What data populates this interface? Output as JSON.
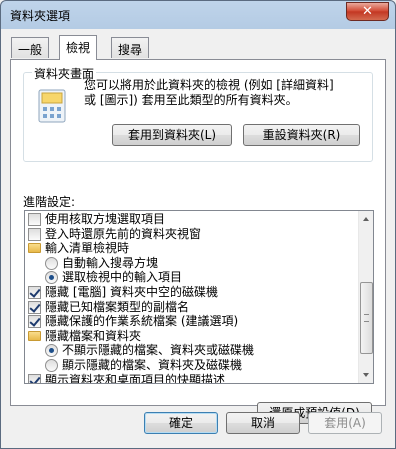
{
  "window": {
    "title": "資料夾選項",
    "close_glyph": "✕"
  },
  "tabs": [
    {
      "label": "一般"
    },
    {
      "label": "檢視"
    },
    {
      "label": "搜尋"
    }
  ],
  "folder_views": {
    "title": "資料夾畫面",
    "description_line1": "您可以將用於此資料夾的檢視 (例如 [詳細資料]",
    "description_line2": "或 [圖示]) 套用至此類型的所有資料夾。",
    "apply_button": "套用到資料夾(L)",
    "reset_button": "重設資料夾(R)"
  },
  "advanced": {
    "label": "進階設定:",
    "items": [
      {
        "type": "checkbox",
        "checked": false,
        "indent": 0,
        "label": "使用核取方塊選取項目"
      },
      {
        "type": "checkbox",
        "checked": false,
        "indent": 0,
        "label": "登入時還原先前的資料夾視窗"
      },
      {
        "type": "folder",
        "indent": 0,
        "label": "輸入清單檢視時"
      },
      {
        "type": "radio",
        "checked": false,
        "indent": 1,
        "label": "自動輸入搜尋方塊"
      },
      {
        "type": "radio",
        "checked": true,
        "indent": 1,
        "label": "選取檢視中的輸入項目"
      },
      {
        "type": "checkbox",
        "checked": true,
        "indent": 0,
        "label": "隱藏 [電腦] 資料夾中空的磁碟機"
      },
      {
        "type": "checkbox",
        "checked": true,
        "indent": 0,
        "label": "隱藏已知檔案類型的副檔名"
      },
      {
        "type": "checkbox",
        "checked": true,
        "indent": 0,
        "label": "隱藏保護的作業系統檔案 (建議選項)"
      },
      {
        "type": "folder",
        "indent": 0,
        "label": "隱藏檔案和資料夾"
      },
      {
        "type": "radio",
        "checked": true,
        "indent": 1,
        "label": "不顯示隱藏的檔案、資料夾或磁碟機"
      },
      {
        "type": "radio",
        "checked": false,
        "indent": 1,
        "label": "顯示隱藏的檔案、資料夾及磁碟機"
      },
      {
        "type": "checkbox",
        "checked": true,
        "indent": 0,
        "label": "顯示資料夾和桌面項目的快顯描述"
      },
      {
        "type": "checkbox",
        "checked": true,
        "indent": 0,
        "label": "顯示預覽窗格中的預覽處理常式"
      }
    ],
    "restore_defaults_button": "還原成預設值(D)"
  },
  "footer": {
    "ok_button": "確定",
    "cancel_button": "取消",
    "apply_button": "套用(A)"
  }
}
